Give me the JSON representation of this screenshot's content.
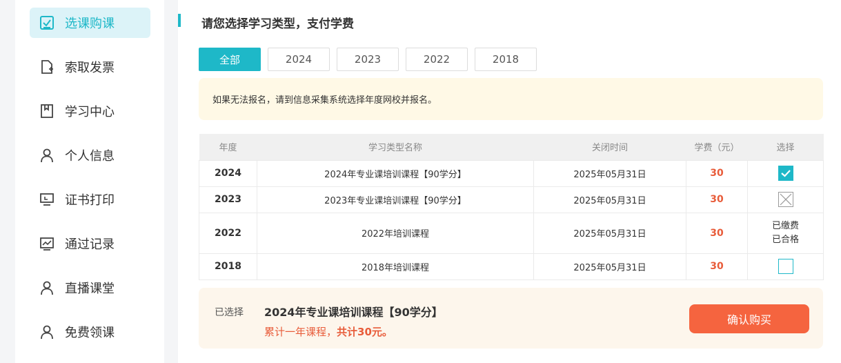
{
  "sidebar": {
    "items": [
      {
        "label": "选课购课",
        "icon": "checkbox-icon",
        "active": true
      },
      {
        "label": "索取发票",
        "icon": "add-file-icon",
        "active": false
      },
      {
        "label": "学习中心",
        "icon": "book-icon",
        "active": false
      },
      {
        "label": "个人信息",
        "icon": "user-icon",
        "active": false
      },
      {
        "label": "证书打印",
        "icon": "monitor-icon",
        "active": false
      },
      {
        "label": "通过记录",
        "icon": "chart-icon",
        "active": false
      },
      {
        "label": "直播课堂",
        "icon": "user-icon",
        "active": false
      },
      {
        "label": "免费领课",
        "icon": "user-icon",
        "active": false
      }
    ]
  },
  "main": {
    "title": "请您选择学习类型，支付学费",
    "tabs": [
      {
        "label": "全部",
        "active": true
      },
      {
        "label": "2024",
        "active": false
      },
      {
        "label": "2023",
        "active": false
      },
      {
        "label": "2022",
        "active": false
      },
      {
        "label": "2018",
        "active": false
      }
    ],
    "notice": "如果无法报名，请到信息采集系统选择年度网校并报名。",
    "table": {
      "headers": [
        "年度",
        "学习类型名称",
        "关闭时间",
        "学费（元）",
        "选择"
      ],
      "rows": [
        {
          "year": "2024",
          "name": "2024年专业课培训课程【90学分】",
          "close": "2025年05月31日",
          "fee": "30",
          "select": "checked"
        },
        {
          "year": "2023",
          "name": "2023年专业课培训课程【90学分】",
          "close": "2025年05月31日",
          "fee": "30",
          "select": "disabled"
        },
        {
          "year": "2022",
          "name": "2022年培训课程",
          "close": "2025年05月31日",
          "fee": "30",
          "select": "status",
          "status_line1": "已缴费",
          "status_line2": "已合格"
        },
        {
          "year": "2018",
          "name": "2018年培训课程",
          "close": "2025年05月31日",
          "fee": "30",
          "select": "empty"
        }
      ]
    },
    "footer": {
      "selected_label": "已选择",
      "selected_course": "2024年专业课培训课程【90学分】",
      "summary_prefix": "累计一年课程，",
      "summary_total": "共计30元。",
      "confirm_label": "确认购买"
    }
  },
  "colors": {
    "accent": "#1eb8c8",
    "price": "#e85c3a",
    "confirm": "#f5643f",
    "notice_bg": "#fff9e6",
    "footer_bg": "#fdf6ec"
  }
}
